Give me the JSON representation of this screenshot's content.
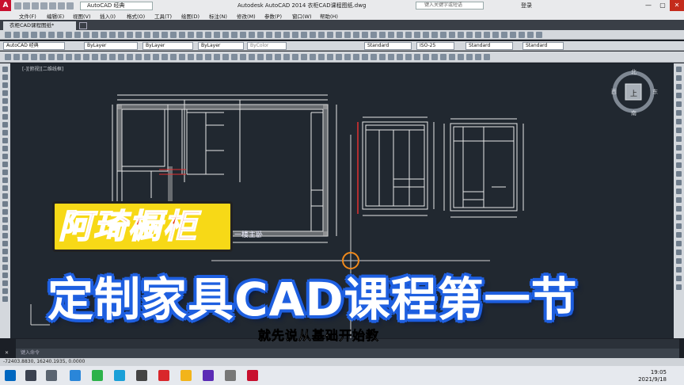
{
  "app": {
    "workspace": "AutoCAD 经典",
    "title": "Autodesk AutoCAD 2014   衣柜CAD课程图纸.dwg",
    "search_placeholder": "键入关键字或短语",
    "login": "登录"
  },
  "menu": [
    "文件(F)",
    "编辑(E)",
    "视图(V)",
    "插入(I)",
    "格式(O)",
    "工具(T)",
    "绘图(D)",
    "标注(N)",
    "修改(M)",
    "参数(P)",
    "窗口(W)",
    "帮助(H)"
  ],
  "file_tab": "衣柜CAD课程图纸*",
  "toolbar": {
    "workspace_combo": "AutoCAD 经典",
    "layer_combo": "ByLayer",
    "linetype_combo": "ByLayer",
    "lineweight_combo": "ByLayer",
    "color_combo": "ByColor",
    "text_style": "Standard",
    "dim_style": "ISO-25",
    "table_style": "Standard",
    "mleader_style": "Standard"
  },
  "viewport_label": "[-][俯视][二维线框]",
  "viewcube": {
    "north": "北",
    "south": "南",
    "east": "东",
    "west": "西",
    "top": "上"
  },
  "drawing": {
    "room_label": "一楼主卧"
  },
  "overlay": {
    "brand": "阿琦橱柜",
    "headline": "定制家具CAD课程第一节",
    "subtitle": "就先说从基础开始教"
  },
  "command": {
    "prompt": "键入命令"
  },
  "status": {
    "coords": "-72403.8830, 16240.1935, 0.0000"
  },
  "taskbar": {
    "time": "19:05",
    "date": "2021/9/18"
  },
  "colors": {
    "canvas": "#212830",
    "brand_bg": "#f7d917",
    "brand_text": "#e8390f",
    "headline_outline": "#1e5fe0",
    "autocad_red": "#c8102e"
  }
}
